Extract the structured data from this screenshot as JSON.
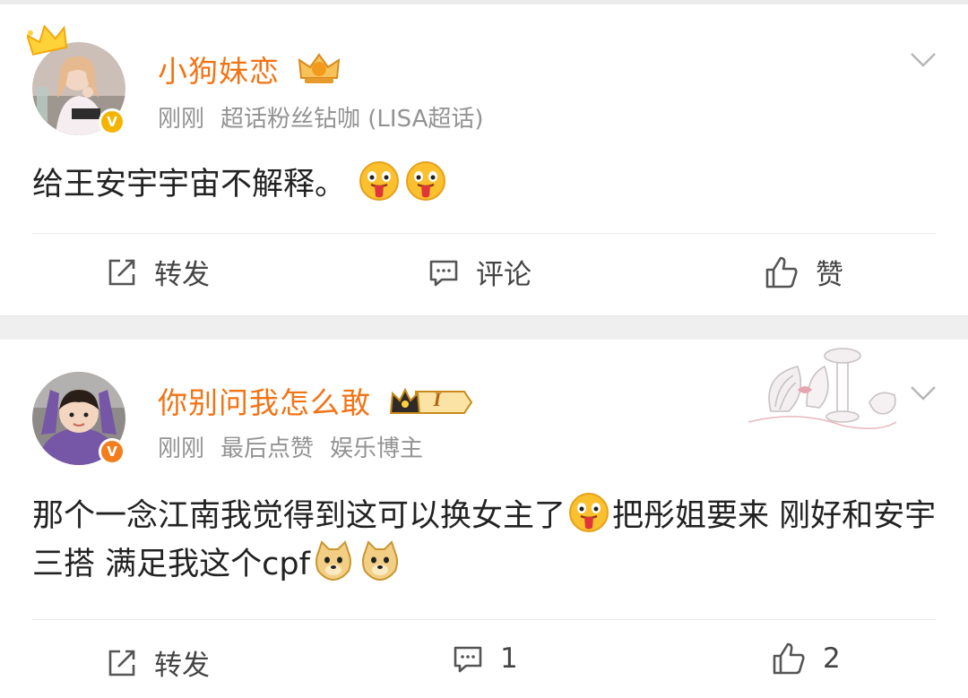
{
  "posts": [
    {
      "author": "小狗妹恋",
      "meta": [
        "刚刚",
        "超话粉丝钻咖 (LISA超话)"
      ],
      "text": "给王安宇宇宙不解释。",
      "emojis": [
        "tongue-out-emoji",
        "tongue-out-emoji"
      ],
      "actions": {
        "repost": "转发",
        "comment": "评论",
        "like": "赞"
      },
      "verify_color": "#f5b400"
    },
    {
      "author": "你别问我怎么敢",
      "meta": [
        "刚刚",
        "最后点赞",
        "娱乐博主"
      ],
      "text_part1": "那个一念江南我觉得到这可以换女主了",
      "text_part2": "把彤姐要来 刚好和安宇三搭 满足我这个cpf",
      "emojis": [
        "tongue-out-emoji",
        "doge-emoji",
        "doge-emoji"
      ],
      "level_badge": "I",
      "actions": {
        "repost": "转发",
        "comment": "1",
        "like": "2"
      },
      "verify_color": "#f27d1c"
    }
  ],
  "colors": {
    "name": "#f37314",
    "meta": "#939393",
    "background_gap": "#efefef"
  }
}
